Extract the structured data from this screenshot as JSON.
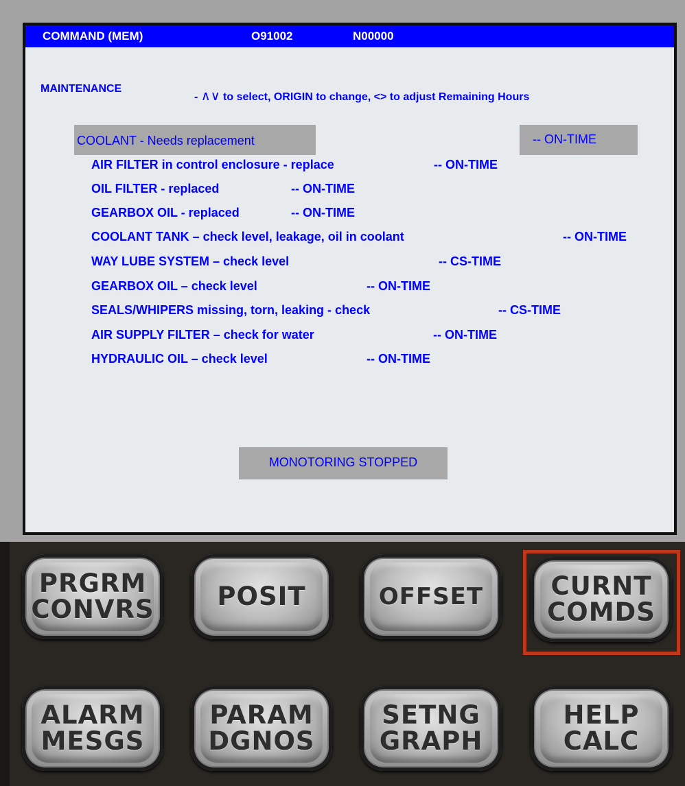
{
  "titlebar": {
    "mode": "COMMAND (MEM)",
    "program": "O91002",
    "sequence": "N00000"
  },
  "header": {
    "label": "MAINTENANCE",
    "instructions_prefix": "- ",
    "arrows": "∧∨",
    "instructions": " to select, ORIGIN to change, <> to adjust Remaining Hours"
  },
  "selected_item": {
    "label": "COOLANT - Needs replacement",
    "status": "--  ON-TIME"
  },
  "items": [
    {
      "label": "AIR FILTER in control enclosure - replace",
      "status": "--  ON-TIME"
    },
    {
      "label": "OIL FILTER - replaced",
      "status": "--  ON-TIME"
    },
    {
      "label": "GEARBOX OIL - replaced",
      "status": "--  ON-TIME"
    },
    {
      "label": "COOLANT TANK – check level, leakage, oil in coolant",
      "status": "--   ON-TIME"
    },
    {
      "label": "WAY LUBE SYSTEM – check level",
      "status": "--   CS-TIME"
    },
    {
      "label": "GEARBOX OIL – check level",
      "status": "--  ON-TIME"
    },
    {
      "label": "SEALS/WHIPERS missing, torn, leaking - check",
      "status": "--  CS-TIME"
    },
    {
      "label": "AIR SUPPLY FILTER – check for water",
      "status": "--  ON-TIME"
    },
    {
      "label": "HYDRAULIC OIL – check level",
      "status": "--  ON-TIME"
    }
  ],
  "footer_status": "MONOTORING STOPPED",
  "keys": [
    {
      "line1": "PRGRM",
      "line2": "CONVRS"
    },
    {
      "line1": "POSIT",
      "line2": ""
    },
    {
      "line1": "OFFSET",
      "line2": ""
    },
    {
      "line1": "CURNT",
      "line2": "COMDS"
    },
    {
      "line1": "ALARM",
      "line2": "MESGS"
    },
    {
      "line1": "PARAM",
      "line2": "DGNOS"
    },
    {
      "line1": "SETNG",
      "line2": "GRAPH"
    },
    {
      "line1": "HELP",
      "line2": "CALC"
    }
  ],
  "colors": {
    "title_bar": "#0000ff",
    "text": "#0000ff",
    "highlight": "#a8a8a8",
    "selected_key_border": "#c0381a"
  }
}
